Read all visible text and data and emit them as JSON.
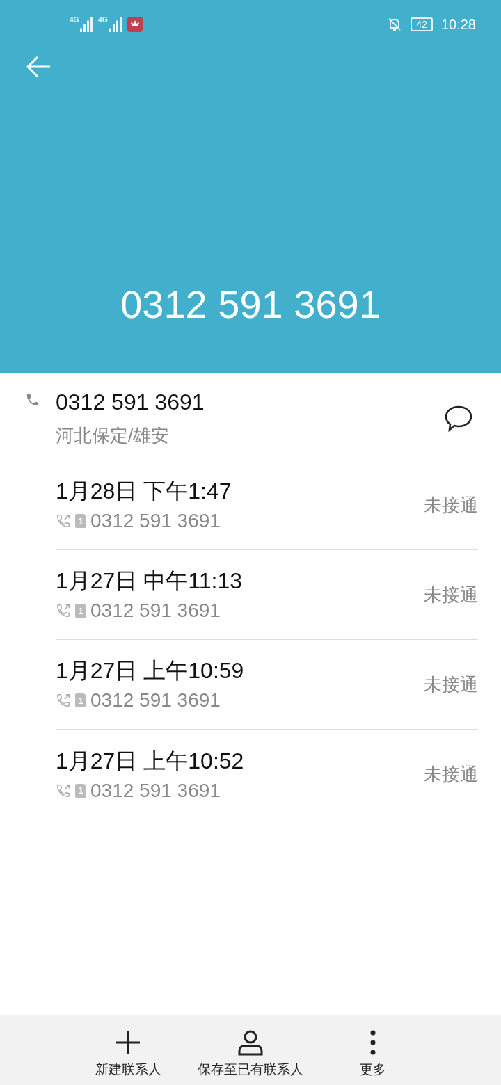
{
  "status_bar": {
    "signals": [
      {
        "label": "4G"
      },
      {
        "label": "4G"
      }
    ],
    "battery": "42",
    "time": "10:28"
  },
  "header": {
    "number": "0312 591 3691"
  },
  "contact": {
    "number": "0312 591 3691",
    "location": "河北保定/雄安"
  },
  "calls": [
    {
      "date": "1月28日 下午1:47",
      "sim": "1",
      "number": "0312 591 3691",
      "status": "未接通"
    },
    {
      "date": "1月27日 中午11:13",
      "sim": "1",
      "number": "0312 591 3691",
      "status": "未接通"
    },
    {
      "date": "1月27日 上午10:59",
      "sim": "1",
      "number": "0312 591 3691",
      "status": "未接通"
    },
    {
      "date": "1月27日 上午10:52",
      "sim": "1",
      "number": "0312 591 3691",
      "status": "未接通"
    }
  ],
  "actions": [
    {
      "kind": "add",
      "label": "新建联系人"
    },
    {
      "kind": "person",
      "label": "保存至已有联系人"
    },
    {
      "kind": "more",
      "label": "更多"
    }
  ]
}
